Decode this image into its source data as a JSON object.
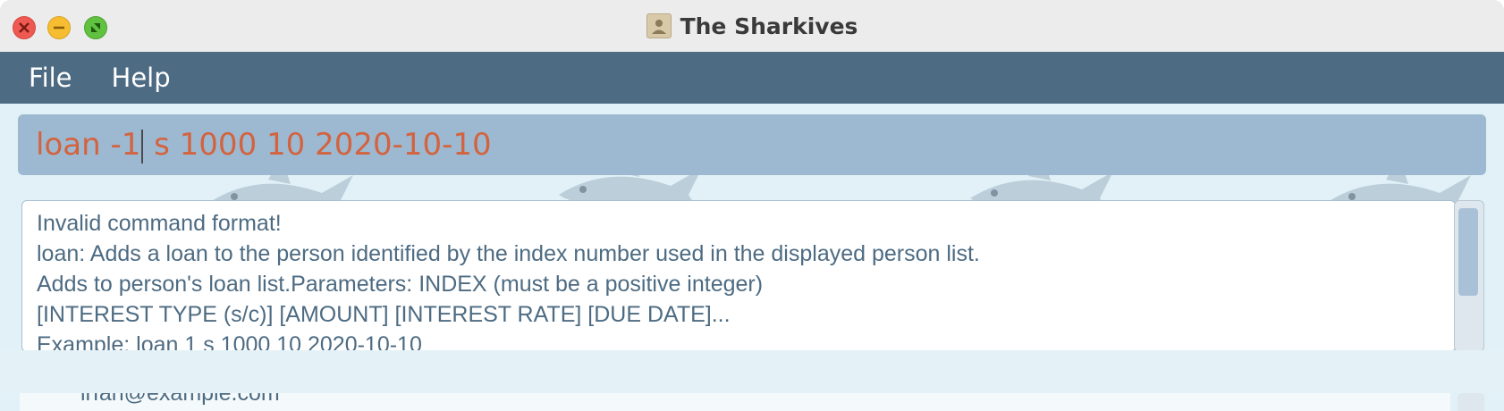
{
  "window": {
    "title": "The Sharkives"
  },
  "menu": {
    "items": [
      "File",
      "Help"
    ]
  },
  "command": {
    "value_before_caret": "loan -1",
    "value_after_caret": " s 1000 10 2020-10-10"
  },
  "result": {
    "lines": [
      "Invalid command format!",
      "loan: Adds a loan to the person identified by the index number used in the displayed person list.",
      "Adds to person's loan list.Parameters: INDEX (must be a positive integer)",
      "[INTEREST TYPE (s/c)] [AMOUNT] [INTEREST RATE] [DUE DATE]...",
      "Example: loan 1 s 1000 10 2020-10-10"
    ]
  },
  "list": {
    "partial_line": "irfan@example.com"
  },
  "colors": {
    "menubar": "#4e6b84",
    "command_text": "#d3633f",
    "result_text": "#4d6b82",
    "command_bg": "#9db9d1"
  }
}
